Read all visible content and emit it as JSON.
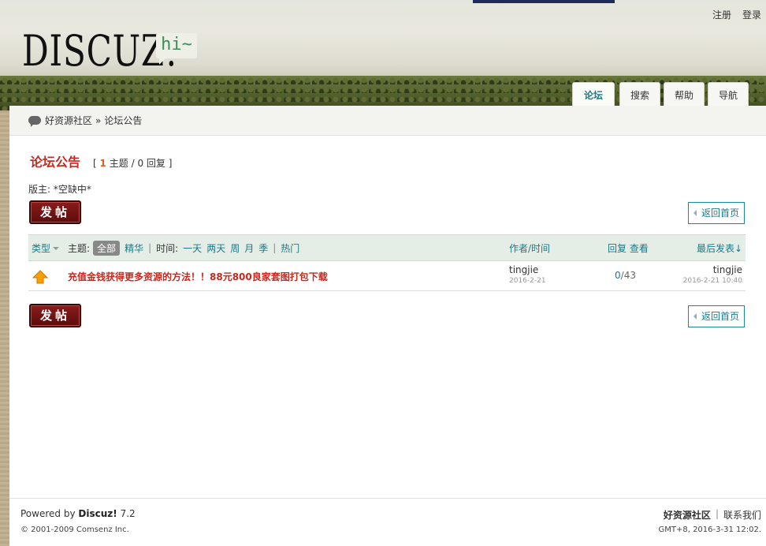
{
  "top_links": {
    "register": "注册",
    "login": "登录"
  },
  "logo": {
    "text": "DISCUZ!",
    "bubble": "hi~"
  },
  "nav": [
    "论坛",
    "搜索",
    "帮助",
    "导航"
  ],
  "breadcrumb": {
    "home": "好资源社区",
    "sep": "»",
    "current": "论坛公告"
  },
  "forum": {
    "title": "论坛公告",
    "stats_open": "[",
    "threads": "1",
    "threads_label": "主题",
    "slash": "/",
    "replies": "0",
    "replies_label": "回复",
    "stats_close": "]",
    "moderator": "版主: *空缺中*"
  },
  "buttons": {
    "post": "发帖",
    "back": "返回首页"
  },
  "table_header": {
    "type": "类型",
    "topic_label": "主题:",
    "all": "全部",
    "digest": "精华",
    "time_label": "时间:",
    "one_day": "一天",
    "two_days": "两天",
    "week": "周",
    "month": "月",
    "season": "季",
    "hot": "热门",
    "author": "作者/时间",
    "replies": "回复",
    "views": "查看",
    "last_post": "最后发表↓"
  },
  "threads": [
    {
      "title": "充值金钱获得更多资源的方法！！88元800良家套图打包下载",
      "author": "tingjie",
      "date": "2016-2-21",
      "replies": "0",
      "views": "43",
      "last_author": "tingjie",
      "last_date": "2016-2-21 10:40"
    }
  ],
  "footer": {
    "powered_prefix": "Powered by",
    "powered_brand": "Discuz!",
    "powered_version": "7.2",
    "copyright": "© 2001-2009 Comsenz Inc.",
    "site": "好资源社区",
    "sep": "|",
    "contact": "联系我们",
    "time": "GMT+8, 2016-3-31 12:02."
  },
  "colors": {
    "accent": "#1a7a8a",
    "title_red": "#c8281e",
    "post_btn": "#6e1212"
  }
}
